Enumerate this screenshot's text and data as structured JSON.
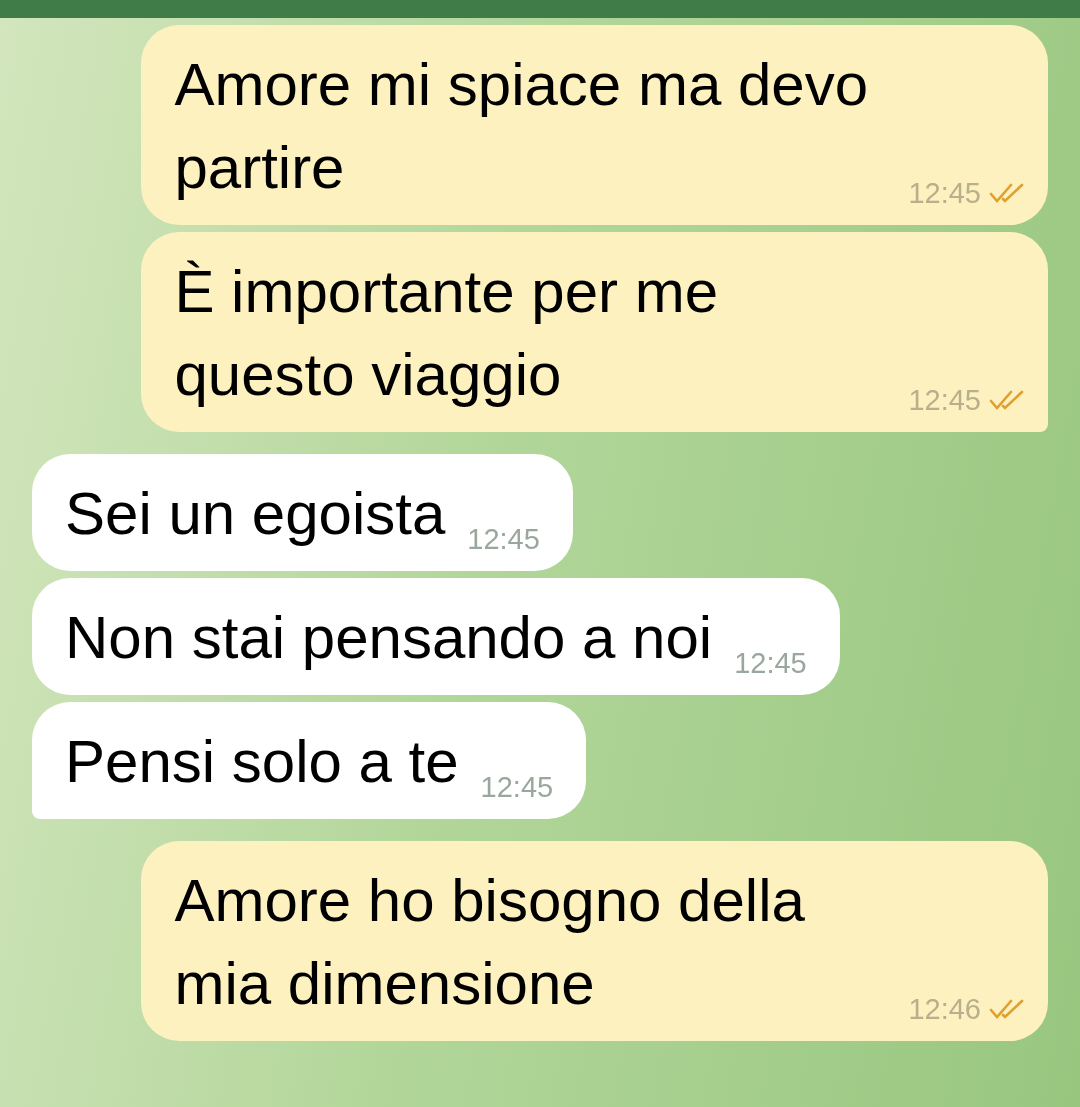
{
  "messages": [
    {
      "kind": "out",
      "text": "Amore mi spiace ma devo partire",
      "time": "12:45",
      "read": true
    },
    {
      "kind": "out",
      "text": "È importante per me questo viaggio",
      "time": "12:45",
      "read": true
    },
    {
      "kind": "in",
      "text": "Sei un egoista",
      "time": "12:45"
    },
    {
      "kind": "in",
      "text": "Non stai pensando a noi",
      "time": "12:45"
    },
    {
      "kind": "in",
      "text": "Pensi solo a te",
      "time": "12:45"
    },
    {
      "kind": "out",
      "text": "Amore ho bisogno della mia dimensione",
      "time": "12:46",
      "read": true
    }
  ]
}
